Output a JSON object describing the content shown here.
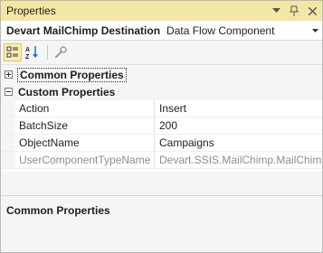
{
  "window": {
    "title": "Properties"
  },
  "object_selector": {
    "name": "Devart MailChimp Destination",
    "type": "Data Flow Component"
  },
  "toolbar": {
    "categorized_icon": "categorized-icon",
    "alphabetical_icon": "alphabetical-icon",
    "property_pages_icon": "wrench-icon"
  },
  "categories": [
    {
      "label": "Common Properties",
      "expanded": false
    },
    {
      "label": "Custom Properties",
      "expanded": true
    }
  ],
  "properties": [
    {
      "name": "Action",
      "value": "Insert",
      "readonly": false
    },
    {
      "name": "BatchSize",
      "value": "200",
      "readonly": false
    },
    {
      "name": "ObjectName",
      "value": "Campaigns",
      "readonly": false
    },
    {
      "name": "UserComponentTypeName",
      "value": "Devart.SSIS.MailChimp.MailChimpDestination",
      "readonly": true
    }
  ],
  "description": {
    "title": "Common Properties"
  },
  "colors": {
    "titlebar": "#f2e7a5",
    "readonly_text": "#8d8d8d"
  }
}
